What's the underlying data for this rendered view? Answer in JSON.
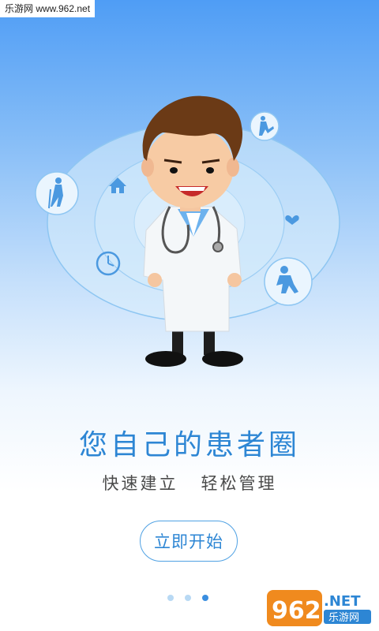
{
  "watermark": {
    "top_text": "乐游网 www.962.net",
    "logo_main": "962",
    "logo_suffix": ".NET",
    "logo_sub": "乐游网"
  },
  "hero": {
    "title": "您自己的患者圈",
    "subtitle": "快速建立   轻松管理"
  },
  "cta": {
    "label": "立即开始"
  },
  "pager": {
    "total": 3,
    "active_index": 2
  },
  "icons": [
    "elderly-person-icon",
    "home-icon",
    "clock-icon",
    "kicking-person-icon",
    "heart-icon",
    "child-running-icon",
    "doctor-illustration"
  ],
  "colors": {
    "accent": "#2d86d4",
    "button_border": "#4fa1e3",
    "dot_active": "#3a8ee0",
    "dot_inactive": "#b8d9f4"
  }
}
